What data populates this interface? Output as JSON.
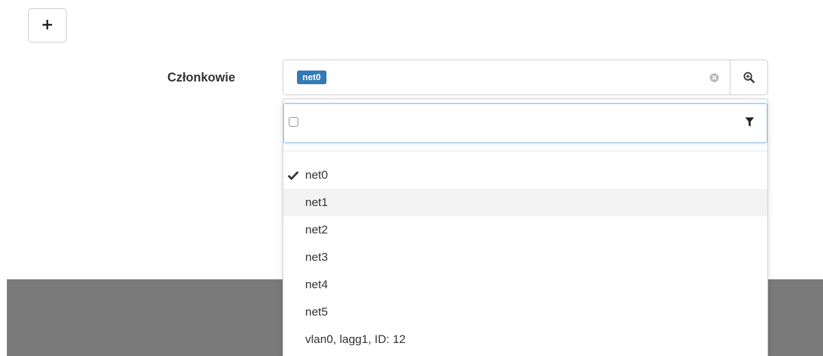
{
  "toolbar": {
    "add_button_label": "+"
  },
  "members_field": {
    "label": "Członkowie",
    "selected_tags": [
      "net0"
    ],
    "clear_icon": "clear-circle-icon",
    "zoom_icon": "zoom-in-icon"
  },
  "dropdown": {
    "filter_value": "",
    "filter_icon": "funnel-icon",
    "options": [
      {
        "label": "net0",
        "selected": true
      },
      {
        "label": "net1",
        "selected": false,
        "hovered": true
      },
      {
        "label": "net2",
        "selected": false
      },
      {
        "label": "net3",
        "selected": false
      },
      {
        "label": "net4",
        "selected": false
      },
      {
        "label": "net5",
        "selected": false
      },
      {
        "label": "vlan0, lagg1, ID: 12",
        "selected": false
      }
    ]
  },
  "colors": {
    "tag_background": "#337ab7",
    "hover_background": "#f3f3f3",
    "footer_band": "#7a7a7a"
  }
}
